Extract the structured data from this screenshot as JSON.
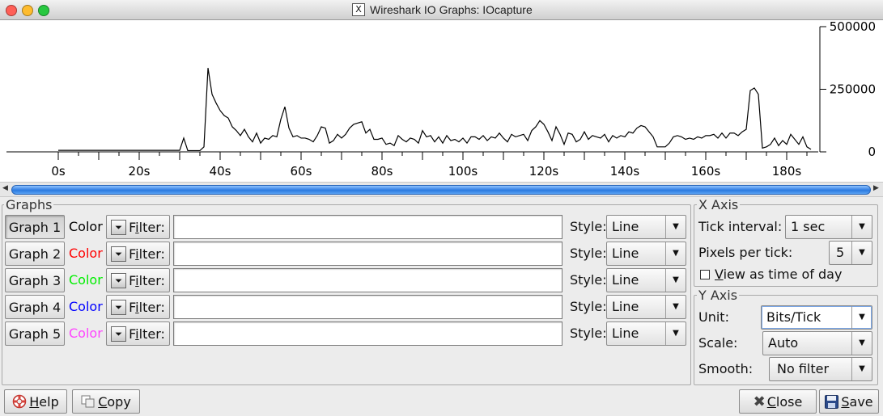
{
  "window": {
    "title": "Wireshark IO Graphs: IOcapture",
    "app_icon_label": "X",
    "traffic_lights": {
      "close": "#ff5f57",
      "minimize": "#febc2e",
      "zoom": "#28c840"
    }
  },
  "chart_data": {
    "type": "line",
    "xlabel": "",
    "ylabel": "",
    "x_tick_labels": [
      "0s",
      "20s",
      "40s",
      "60s",
      "80s",
      "100s",
      "120s",
      "140s",
      "160s",
      "180s"
    ],
    "y_tick_labels": [
      "500000",
      "250000",
      "0"
    ],
    "xlim": [
      0,
      188
    ],
    "ylim": [
      0,
      500000
    ],
    "series": [
      {
        "color": "#000000",
        "x": [
          0,
          1,
          2,
          3,
          4,
          5,
          6,
          7,
          8,
          9,
          10,
          11,
          12,
          13,
          14,
          15,
          16,
          17,
          18,
          19,
          20,
          21,
          22,
          23,
          24,
          25,
          26,
          27,
          28,
          29,
          30,
          31,
          32,
          33,
          34,
          35,
          36,
          37,
          38,
          39,
          40,
          41,
          42,
          43,
          44,
          45,
          46,
          47,
          48,
          49,
          50,
          51,
          52,
          53,
          54,
          55,
          56,
          57,
          58,
          59,
          60,
          61,
          62,
          63,
          64,
          65,
          66,
          67,
          68,
          69,
          70,
          71,
          72,
          73,
          74,
          75,
          76,
          77,
          78,
          79,
          80,
          81,
          82,
          83,
          84,
          85,
          86,
          87,
          88,
          89,
          90,
          91,
          92,
          93,
          94,
          95,
          96,
          97,
          98,
          99,
          100,
          101,
          102,
          103,
          104,
          105,
          106,
          107,
          108,
          109,
          110,
          111,
          112,
          113,
          114,
          115,
          116,
          117,
          118,
          119,
          120,
          121,
          122,
          123,
          124,
          125,
          126,
          127,
          128,
          129,
          130,
          131,
          132,
          133,
          134,
          135,
          136,
          137,
          138,
          139,
          140,
          141,
          142,
          143,
          144,
          145,
          146,
          147,
          148,
          149,
          150,
          151,
          152,
          153,
          154,
          155,
          156,
          157,
          158,
          159,
          160,
          161,
          162,
          163,
          164,
          165,
          166,
          167,
          168,
          169,
          170,
          171,
          172,
          173,
          174,
          175,
          176,
          177,
          178,
          179,
          180,
          181,
          182,
          183,
          184,
          185,
          186
        ],
        "y": [
          6000,
          6000,
          6000,
          6000,
          6000,
          6000,
          6000,
          6000,
          6000,
          6000,
          6000,
          6000,
          6000,
          6000,
          6000,
          6000,
          6000,
          6000,
          6000,
          6000,
          6000,
          6000,
          6000,
          6000,
          6000,
          6000,
          6000,
          6000,
          6000,
          6000,
          6000,
          55000,
          5000,
          5000,
          5000,
          5000,
          20000,
          335000,
          230000,
          195000,
          165000,
          145000,
          135000,
          100000,
          85000,
          65000,
          90000,
          60000,
          40000,
          75000,
          35000,
          55000,
          50000,
          65000,
          60000,
          130000,
          180000,
          95000,
          60000,
          65000,
          55000,
          55000,
          50000,
          40000,
          65000,
          100000,
          95000,
          35000,
          45000,
          70000,
          55000,
          70000,
          95000,
          110000,
          115000,
          120000,
          75000,
          90000,
          50000,
          50000,
          55000,
          30000,
          35000,
          25000,
          65000,
          50000,
          40000,
          55000,
          50000,
          35000,
          85000,
          60000,
          65000,
          40000,
          60000,
          35000,
          65000,
          45000,
          50000,
          40000,
          55000,
          35000,
          60000,
          60000,
          50000,
          65000,
          45000,
          60000,
          55000,
          75000,
          55000,
          40000,
          70000,
          60000,
          65000,
          70000,
          45000,
          85000,
          100000,
          125000,
          110000,
          80000,
          45000,
          100000,
          70000,
          30000,
          75000,
          70000,
          40000,
          50000,
          80000,
          50000,
          65000,
          60000,
          55000,
          70000,
          40000,
          65000,
          55000,
          65000,
          60000,
          80000,
          75000,
          95000,
          105000,
          100000,
          80000,
          60000,
          20000,
          20000,
          20000,
          35000,
          60000,
          65000,
          60000,
          50000,
          55000,
          50000,
          60000,
          55000,
          65000,
          65000,
          70000,
          55000,
          75000,
          55000,
          75000,
          75000,
          65000,
          80000,
          90000,
          245000,
          255000,
          230000,
          15000,
          20000,
          30000,
          55000,
          25000,
          45000,
          30000,
          70000,
          50000,
          30000,
          60000,
          20000,
          10000
        ]
      }
    ]
  },
  "scroll": {
    "left_arrow": "◀",
    "right_arrow": "▶"
  },
  "graphs_panel": {
    "title": "Graphs",
    "color_label": "Color",
    "filter_label": "Filter:",
    "style_label": "Style:",
    "rows": [
      {
        "name": "Graph 1",
        "color": "#000000",
        "style": "Line",
        "filter": ""
      },
      {
        "name": "Graph 2",
        "color": "#ff0000",
        "style": "Line",
        "filter": ""
      },
      {
        "name": "Graph 3",
        "color": "#00ee00",
        "style": "Line",
        "filter": ""
      },
      {
        "name": "Graph 4",
        "color": "#0000ff",
        "style": "Line",
        "filter": ""
      },
      {
        "name": "Graph 5",
        "color": "#ff44ff",
        "style": "Line",
        "filter": ""
      }
    ]
  },
  "x_axis": {
    "title": "X Axis",
    "tick_interval_label": "Tick interval:",
    "tick_interval_value": "1 sec",
    "pixels_per_tick_label": "Pixels per tick:",
    "pixels_per_tick_value": "5",
    "view_time_of_day_label": "View as time of day",
    "view_time_of_day_checked": false
  },
  "y_axis": {
    "title": "Y Axis",
    "unit_label": "Unit:",
    "unit_value": "Bits/Tick",
    "scale_label": "Scale:",
    "scale_value": "Auto",
    "smooth_label": "Smooth:",
    "smooth_value": "No filter"
  },
  "footer": {
    "help_label": "Help",
    "copy_label": "Copy",
    "close_label": "Close",
    "save_label": "Save"
  }
}
